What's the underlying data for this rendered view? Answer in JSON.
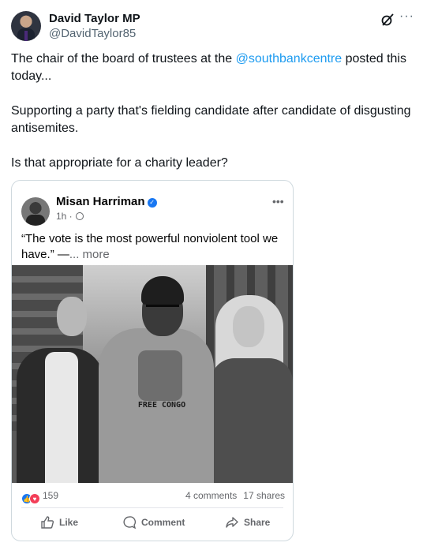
{
  "author": {
    "name": "David Taylor MP",
    "handle": "@DavidTaylor85"
  },
  "tweet": {
    "line1_prefix": "The chair of the board of trustees at the ",
    "mention": "@southbankcentre",
    "line1_suffix": " posted this today...",
    "paragraph2": "Supporting a party that's fielding candidate after candidate of disgusting antisemites.",
    "paragraph3": "Is that appropriate for a charity leader?"
  },
  "embed": {
    "name": "Misan  Harriman",
    "time": "1h · ",
    "text": "“The vote is the most powerful nonviolent tool we have.” —",
    "more_label": "... more",
    "shirt_text": "FREE CONGO",
    "reaction_count": "159",
    "comments": "4 comments",
    "shares": "17 shares",
    "actions": {
      "like": "Like",
      "comment": "Comment",
      "share": "Share"
    }
  },
  "colors": {
    "link": "#1d9bf0",
    "fb_blue": "#1877f2",
    "love_red": "#f33e58"
  },
  "icons": {
    "header": [
      "grok-icon",
      "more-icon"
    ],
    "embed": [
      "verified-icon",
      "globe-icon",
      "like-icon",
      "love-icon",
      "comment-icon",
      "share-icon"
    ]
  }
}
